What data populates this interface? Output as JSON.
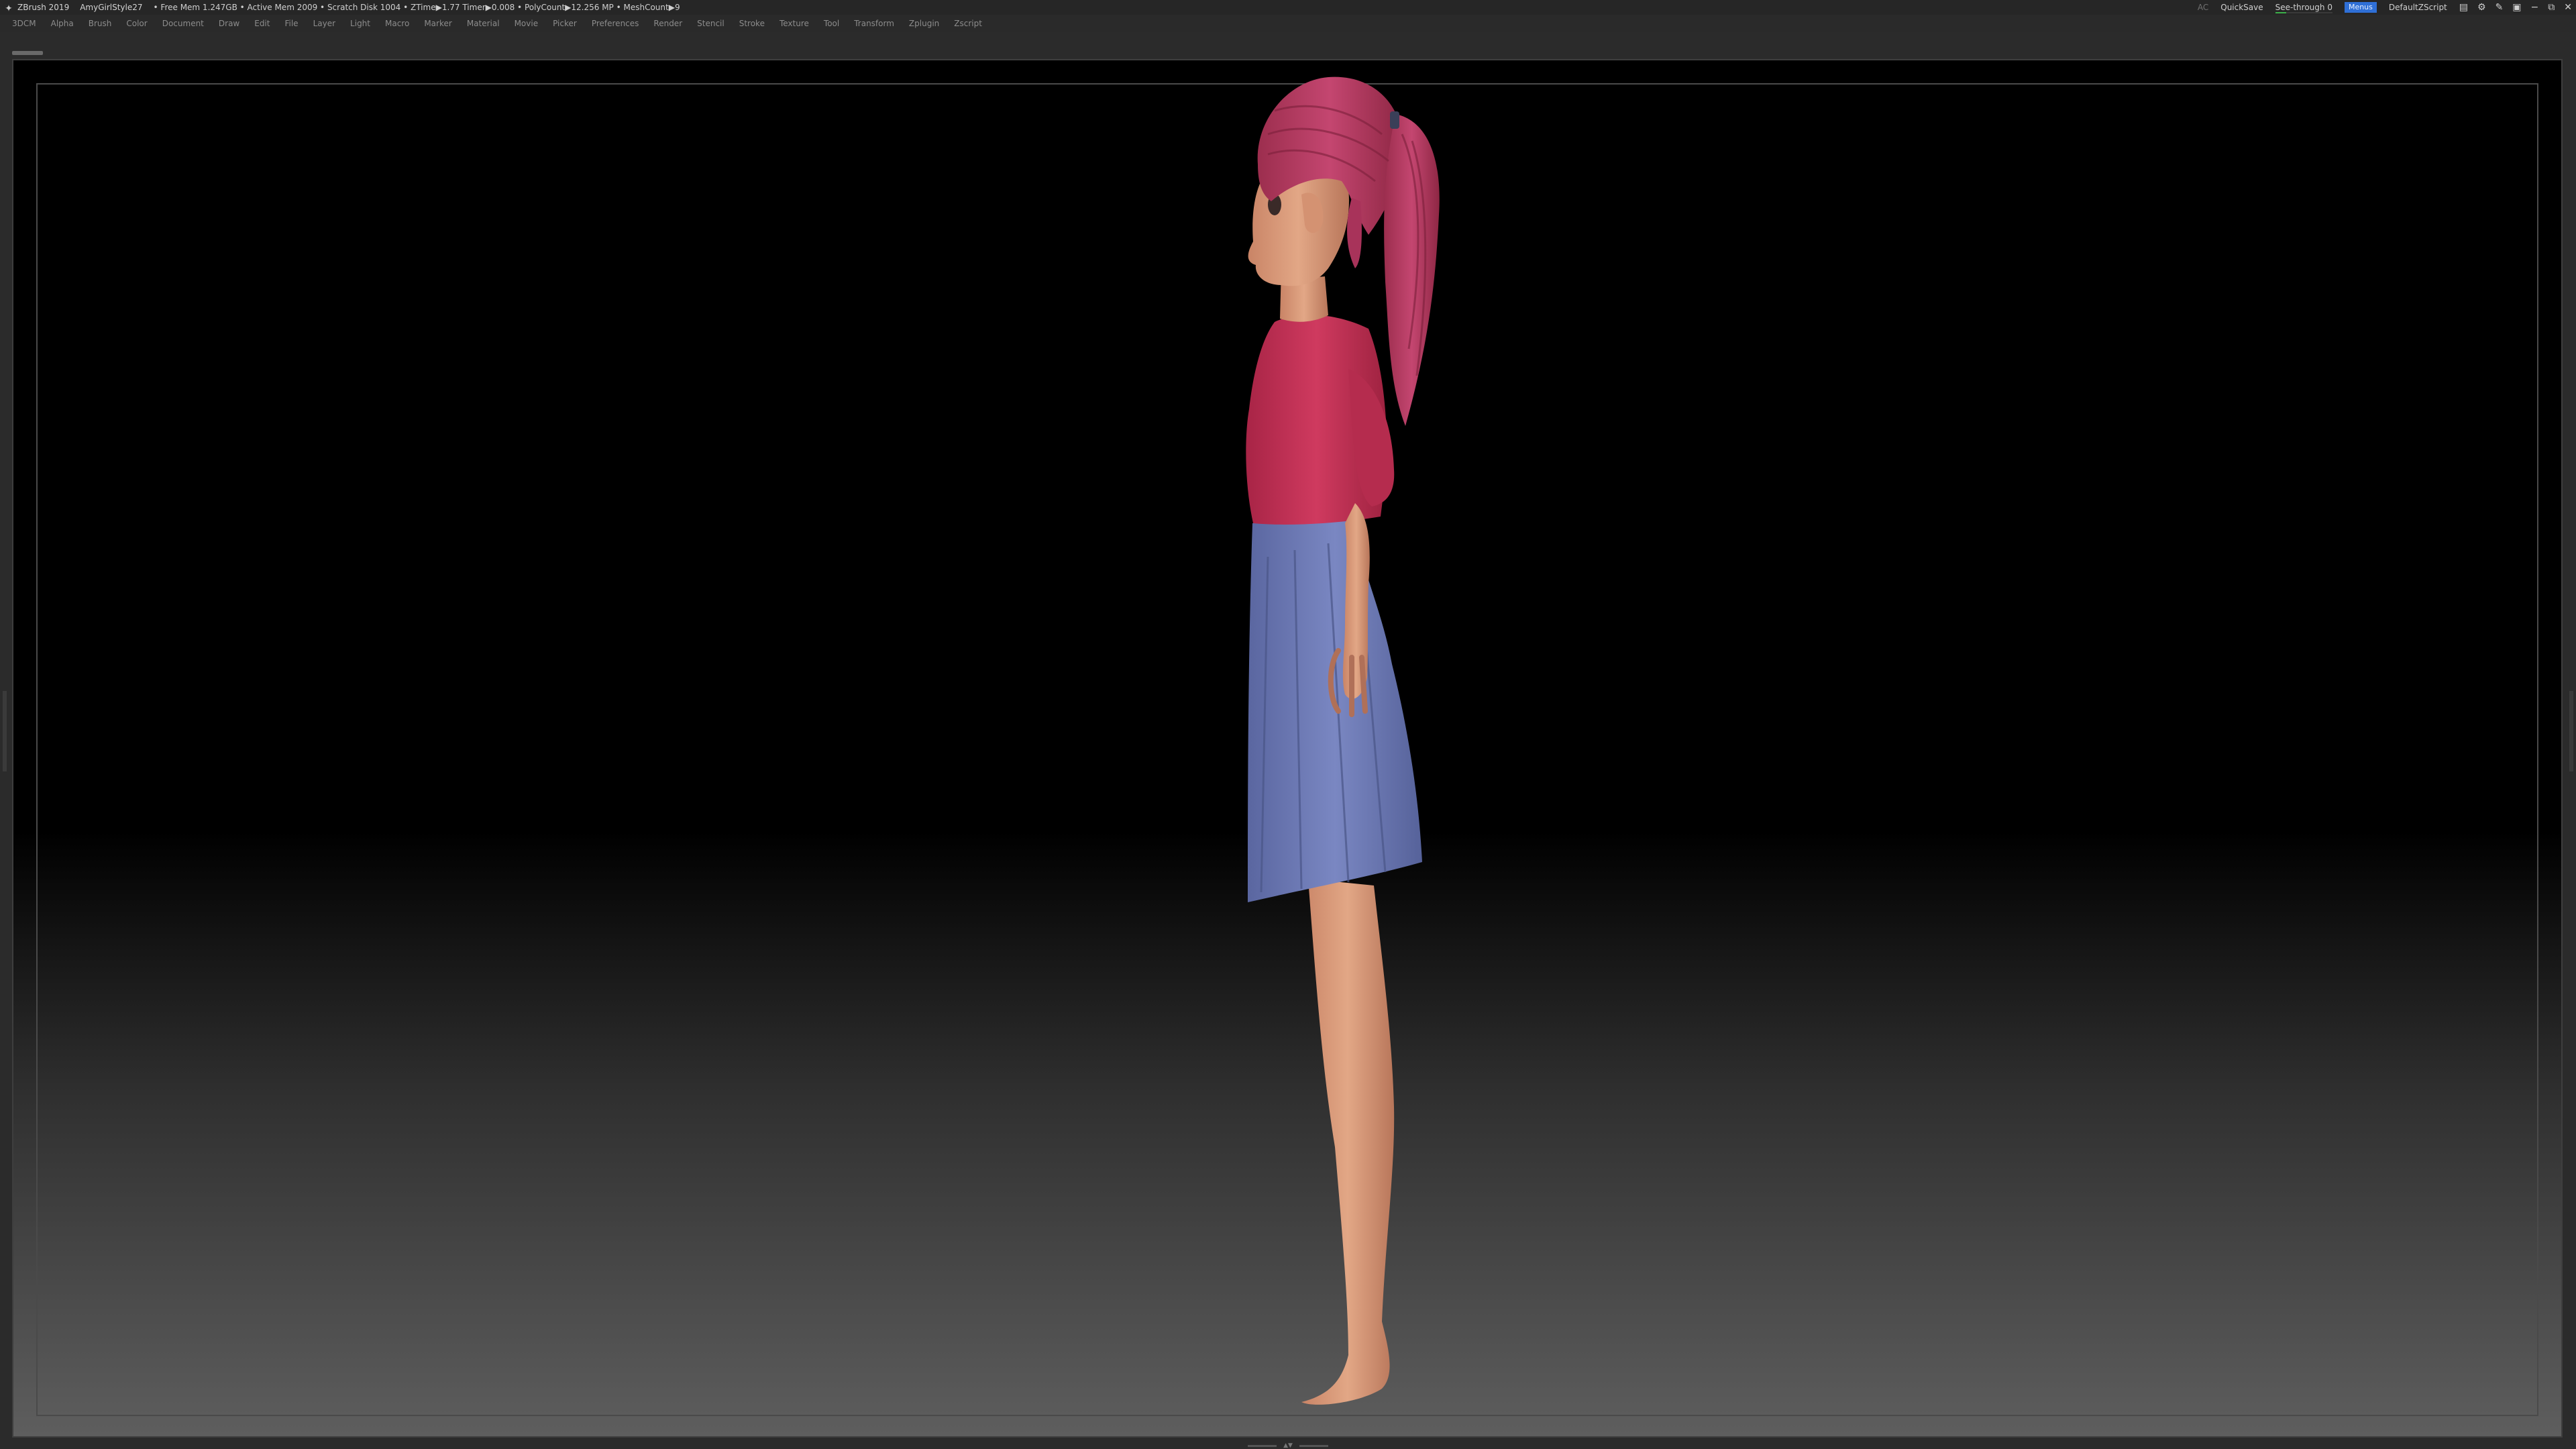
{
  "titlebar": {
    "app": "ZBrush 2019",
    "document": "AmyGirlStyle27",
    "stats": "• Free Mem 1.247GB • Active Mem 2009 • Scratch Disk 1004 • ZTime▶1.77 Timer▶0.008 • PolyCount▶12.256 MP • MeshCount▶9",
    "ac_label": "AC",
    "quicksave_label": "QuickSave",
    "see_through_label": "See-through 0",
    "see_through_value": 0,
    "menus_label": "Menus",
    "script_label": "DefaultZScript",
    "icons": [
      "layout-icon",
      "gear-icon",
      "brush-icon",
      "lock-icon",
      "minimize-icon",
      "restore-icon",
      "close-icon"
    ]
  },
  "menubar": {
    "items": [
      "3DCM",
      "Alpha",
      "Brush",
      "Color",
      "Document",
      "Draw",
      "Edit",
      "File",
      "Layer",
      "Light",
      "Macro",
      "Marker",
      "Material",
      "Movie",
      "Picker",
      "Preferences",
      "Render",
      "Stencil",
      "Stroke",
      "Texture",
      "Tool",
      "Transform",
      "Zplugin",
      "Zscript"
    ]
  },
  "viewport": {
    "subject": "female-character-model-side-view",
    "colors": {
      "hair": "#b73a5e",
      "shirt": "#c23154",
      "skirt": "#6d7ab6",
      "skin": "#d99a78",
      "background_top": "#000000",
      "background_bottom": "#5e5e5e"
    }
  }
}
